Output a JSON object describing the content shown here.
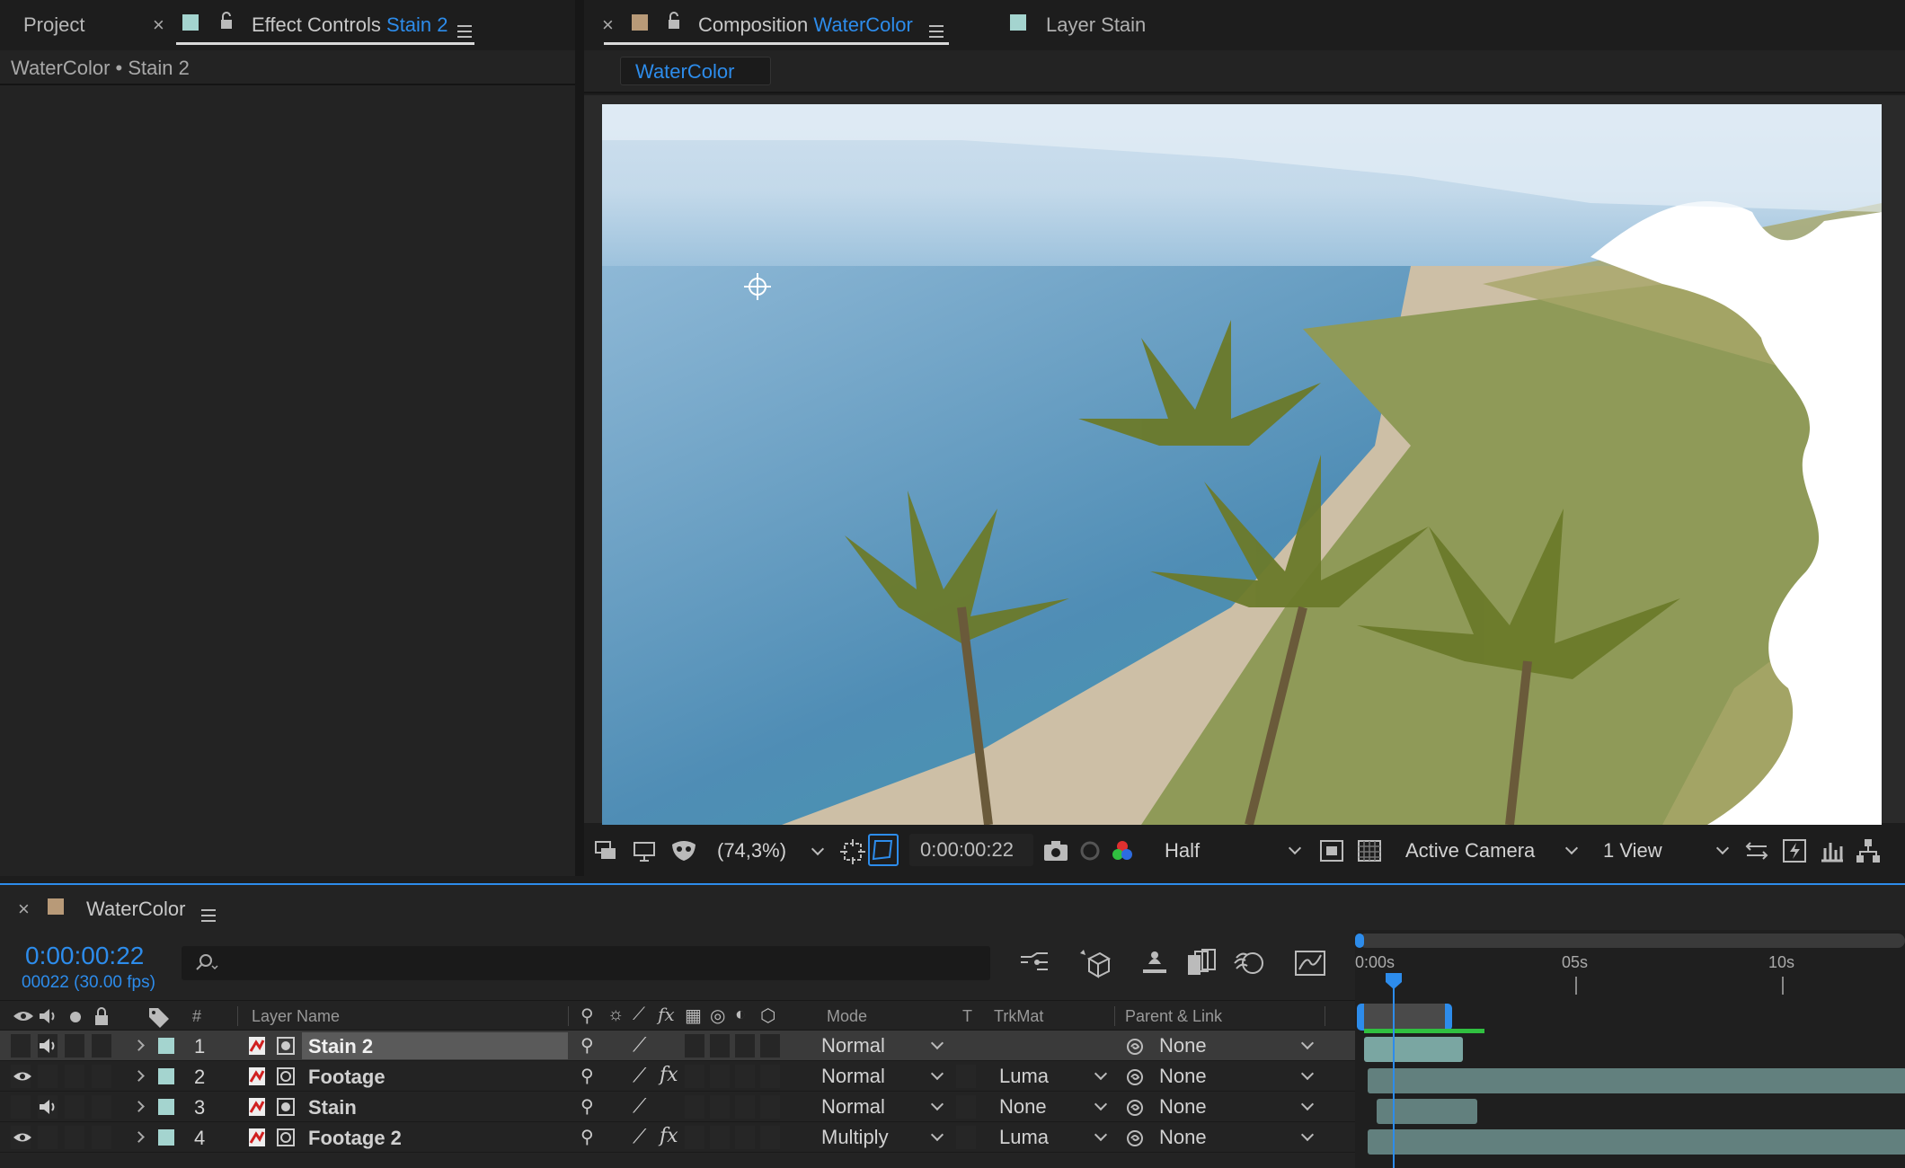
{
  "left_panel": {
    "tab_project": "Project",
    "tab_effect_controls_prefix": "Effect Controls",
    "tab_effect_controls_layer": "Stain 2",
    "breadcrumb": "WaterColor • Stain 2"
  },
  "viewer": {
    "tab_composition_prefix": "Composition",
    "tab_composition_name": "WaterColor",
    "tab_layer": "Layer Stain",
    "comp_button": "WaterColor",
    "zoom": "(74,3%)",
    "timecode": "0:00:00:22",
    "resolution": "Half",
    "camera": "Active Camera",
    "views": "1 View"
  },
  "timeline": {
    "tab_name": "WaterColor",
    "timecode": "0:00:00:22",
    "frames": "00022 (30.00 fps)",
    "search_placeholder": "",
    "ruler": [
      "0:00s",
      "05s",
      "10s"
    ],
    "columns": {
      "number": "#",
      "layer_name": "Layer Name",
      "mode": "Mode",
      "t": "T",
      "trkmat": "TrkMat",
      "parent": "Parent & Link"
    },
    "layers": [
      {
        "num": "1",
        "name": "Stain 2",
        "mode": "Normal",
        "trkmat": "",
        "parent": "None",
        "eye": false,
        "audio": true,
        "fx": false
      },
      {
        "num": "2",
        "name": "Footage",
        "mode": "Normal",
        "trkmat": "Luma",
        "parent": "None",
        "eye": true,
        "audio": false,
        "fx": true
      },
      {
        "num": "3",
        "name": "Stain",
        "mode": "Normal",
        "trkmat": "None",
        "parent": "None",
        "eye": false,
        "audio": true,
        "fx": false
      },
      {
        "num": "4",
        "name": "Footage 2",
        "mode": "Multiply",
        "trkmat": "Luma",
        "parent": "None",
        "eye": true,
        "audio": false,
        "fx": true
      }
    ]
  },
  "colors": {
    "accent": "#2d8ceb",
    "label_aqua": "#a4d4cf",
    "label_tan": "#b89a78",
    "panel": "#232323",
    "background": "#1d1d1d"
  }
}
